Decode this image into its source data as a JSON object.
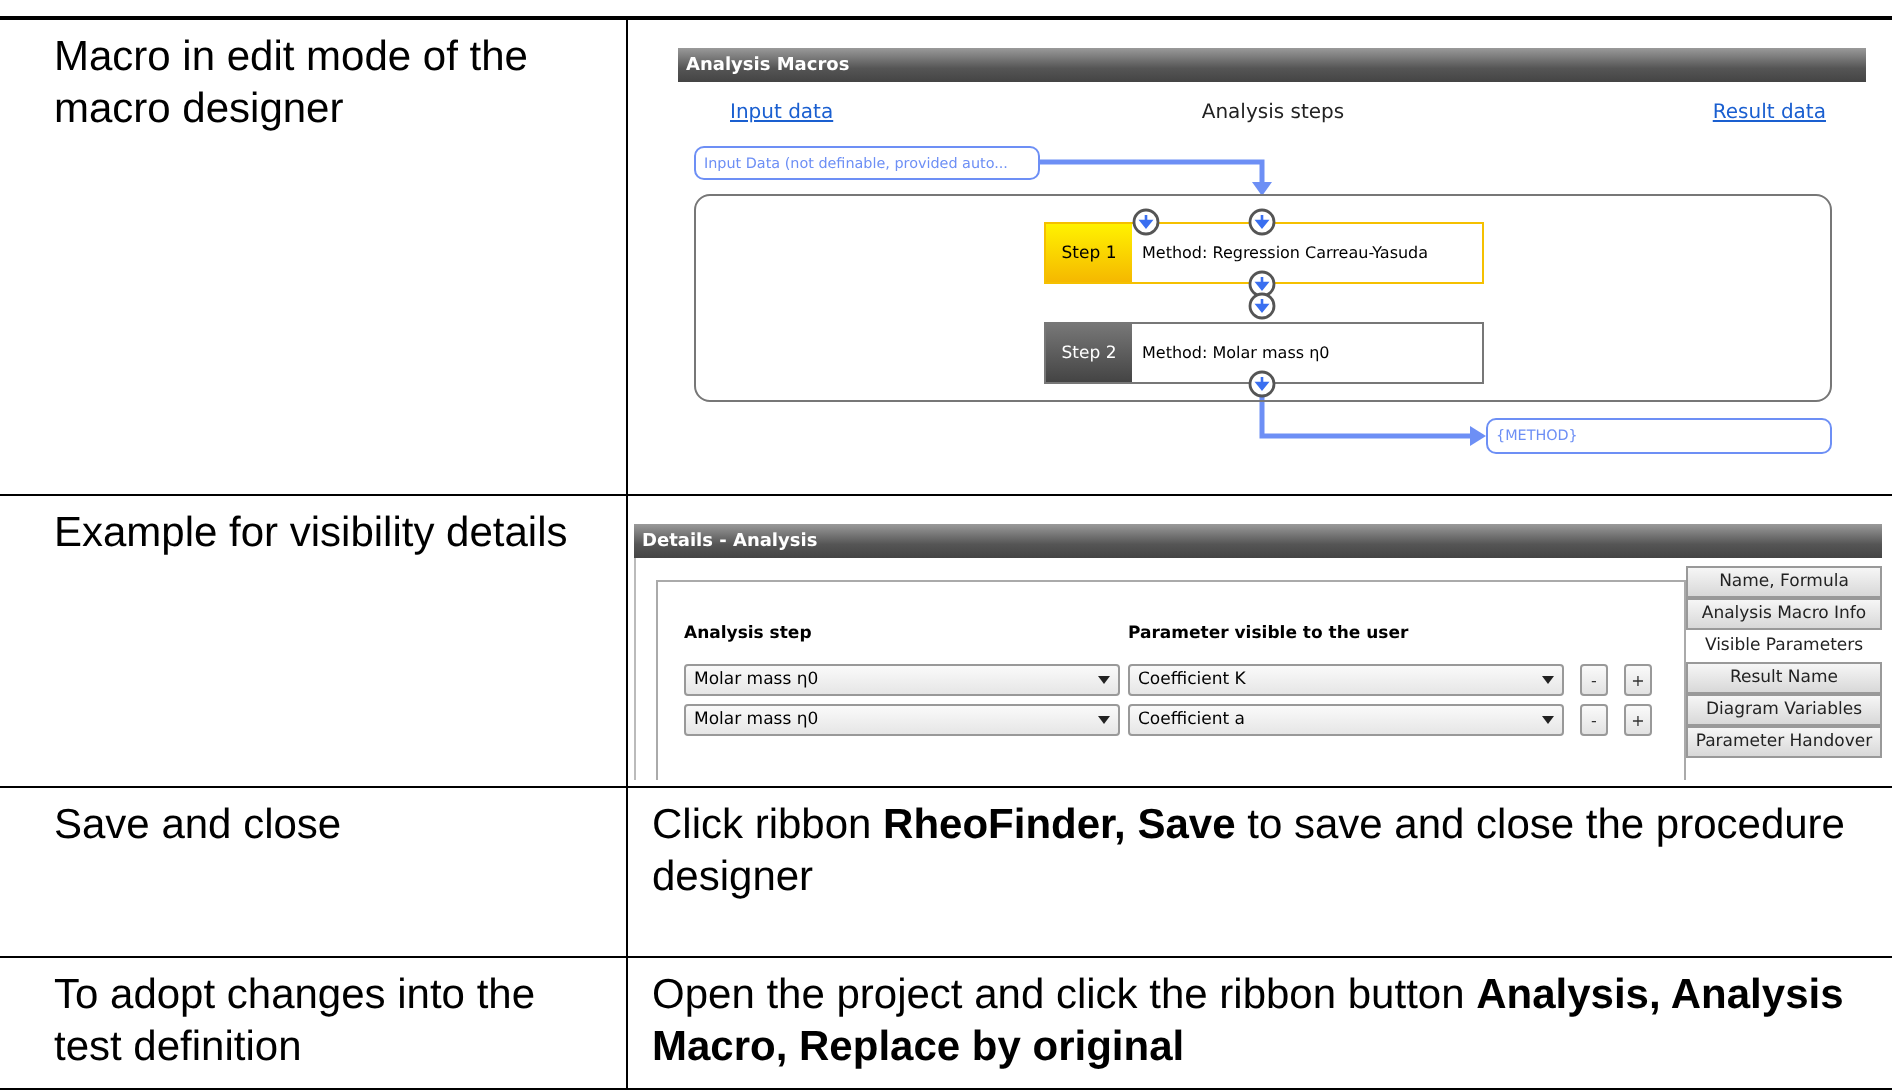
{
  "rows": [
    {
      "kind": "macro",
      "label": "Macro in edit mode of the macro designer",
      "macro": {
        "title": "Analysis Macros",
        "input_link": "Input data",
        "steps_heading": "Analysis steps",
        "result_link": "Result data",
        "input_box": "Input Data (not definable, provided auto...",
        "steps": [
          {
            "label": "Step 1",
            "method": "Method:  Regression Carreau-Yasuda",
            "selected": true
          },
          {
            "label": "Step 2",
            "method": "Method:  Molar mass η0",
            "selected": false
          }
        ],
        "result_box": "{METHOD}"
      }
    },
    {
      "kind": "details",
      "label": "Example for visibility details",
      "details": {
        "title": "Details - Analysis",
        "columns": [
          "Analysis step",
          "Parameter visible to the user"
        ],
        "rows": [
          {
            "step": "Molar mass η0",
            "parameter": "Coefficient K",
            "remove_button": "-",
            "add_button": "+"
          },
          {
            "step": "Molar mass η0",
            "parameter": "Coefficient a",
            "remove_button": "-",
            "add_button": "+"
          }
        ],
        "tabs": [
          {
            "label": "Name, Formula",
            "selected": false
          },
          {
            "label": "Analysis Macro Info",
            "selected": false
          },
          {
            "label": "Visible Parameters",
            "selected": true
          },
          {
            "label": "Result Name",
            "selected": false
          },
          {
            "label": "Diagram Variables",
            "selected": false
          },
          {
            "label": "Parameter Handover",
            "selected": false
          }
        ]
      }
    },
    {
      "kind": "text",
      "label": "Save and close",
      "text": "Click ribbon **RheoFinder, Save** to save and close the procedure designer"
    },
    {
      "kind": "text",
      "label": "To adopt changes into the test definition",
      "text": "Open the project and click the ribbon button **Analysis, Analysis Macro, Replace by original**"
    }
  ]
}
